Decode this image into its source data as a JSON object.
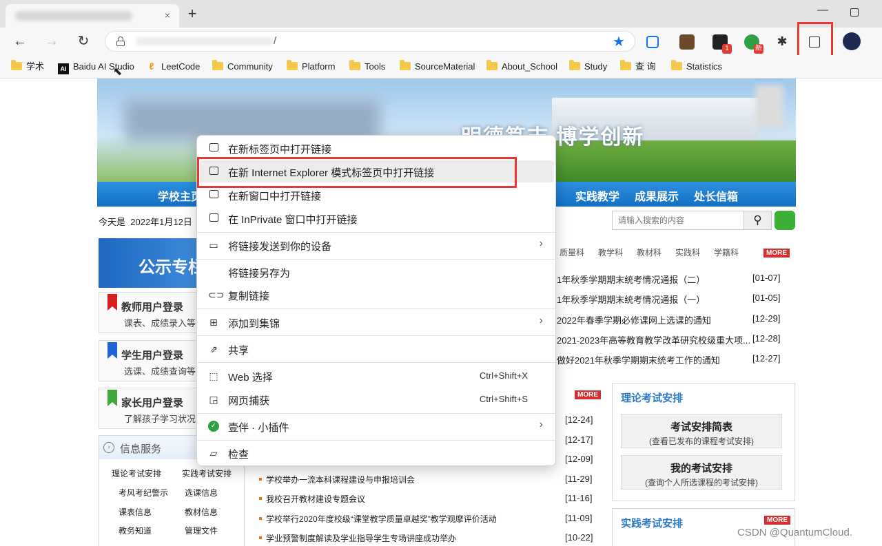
{
  "browser": {
    "tab_close": "×",
    "new_tab": "+",
    "minimize": "—",
    "url_suffix": "/",
    "bookmarks": [
      "学术",
      "Baidu AI Studio",
      "LeetCode",
      "Community",
      "Platform",
      "Tools",
      "SourceMaterial",
      "About_School",
      "Study",
      "查 询",
      "Statistics"
    ],
    "extension_badge": "1",
    "extension_badge2": "新"
  },
  "site": {
    "slogan": "明德笃志  博学创新",
    "nav": [
      "学校主页",
      "实践教学",
      "成果展示",
      "处长信箱"
    ],
    "date_prefix": "今天是",
    "date": "2022年1月12日",
    "search_placeholder": "请输入搜索的内容",
    "announce": "公示专栏",
    "logins": [
      {
        "title": "教师用户登录",
        "sub": "课表、成绩录入等"
      },
      {
        "title": "学生用户登录",
        "sub": "选课、成绩查询等"
      },
      {
        "title": "家长用户登录",
        "sub": "了解孩子学习状况"
      }
    ],
    "info_title": "信息服务",
    "info_links": [
      "理论考试安排",
      "实践考试安排",
      "考风考纪警示",
      "选课信息",
      "课表信息",
      "教材信息",
      "教务知道",
      "管理文件"
    ],
    "tabs": [
      "质量科",
      "教学科",
      "教材科",
      "实践科",
      "学籍科"
    ],
    "more": "MORE",
    "news": [
      {
        "text": "1年秋季学期期末统考情况通报（二）",
        "date": "[01-07]"
      },
      {
        "text": "1年秋季学期期末统考情况通报（一）",
        "date": "[01-05]"
      },
      {
        "text": "2022年春季学期必修课网上选课的通知",
        "date": "[12-29]"
      },
      {
        "text": "2021-2023年高等教育教学改革研究校级重大项...",
        "date": "[12-28]"
      },
      {
        "text": "做好2021年秋季学期期末统考工作的通知",
        "date": "[12-27]"
      }
    ],
    "list_dates_top": [
      "[12-24]",
      "[12-17]",
      "[12-09]"
    ],
    "list": [
      {
        "text": "学校举办一流本科课程建设与申报培训会",
        "date": "[11-29]"
      },
      {
        "text": "我校召开教材建设专题会议",
        "date": "[11-16]"
      },
      {
        "text": "学校举行2020年度校级“课堂教学质量卓越奖”教学观摩评价活动",
        "date": "[11-09]"
      },
      {
        "text": "学业预警制度解读及学业指导学生专场讲座成功举办",
        "date": "[10-22]"
      }
    ],
    "exam_title": "理论考试安排",
    "exam_buttons": [
      {
        "title": "考试安排简表",
        "sub": "(查看已发布的课程考试安排)"
      },
      {
        "title": "我的考试安排",
        "sub": "(查询个人所选课程的考试安排)"
      }
    ],
    "practice_title": "实践考试安排",
    "watermark": "CSDN @QuantumCloud."
  },
  "context_menu": {
    "items": [
      {
        "label": "在新标签页中打开链接"
      },
      {
        "label": "在新 Internet Explorer 模式标签页中打开链接"
      },
      {
        "label": "在新窗口中打开链接"
      },
      {
        "label": "在 InPrivate 窗口中打开链接"
      },
      {
        "label": "将链接发送到你的设备",
        "arrow": "›"
      },
      {
        "label": "将链接另存为"
      },
      {
        "label": "复制链接"
      },
      {
        "label": "添加到集锦",
        "arrow": "›"
      },
      {
        "label": "共享"
      },
      {
        "label": "Web 选择",
        "shortcut": "Ctrl+Shift+X"
      },
      {
        "label": "网页捕获",
        "shortcut": "Ctrl+Shift+S"
      },
      {
        "label": "壹伴 · 小插件",
        "arrow": "›"
      },
      {
        "label": "检查"
      }
    ]
  },
  "colors": {
    "accent": "#1a73e8",
    "highlight": "#e53935",
    "nav_blue": "#136fc2"
  }
}
